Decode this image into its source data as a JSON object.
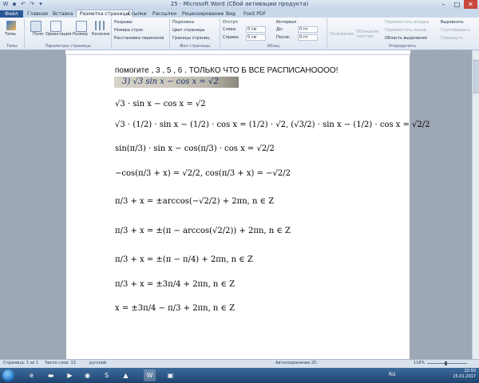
{
  "window": {
    "title": "25 - Microsoft Word (Сбой активации продукта)"
  },
  "tabs": [
    "Файл",
    "Главная",
    "Вставка",
    "Разметка страницы",
    "Ссылки",
    "Рассылки",
    "Рецензирование",
    "Вид",
    "Foxit PDF"
  ],
  "ribbon": {
    "themes": {
      "label": "Темы",
      "group": "Темы"
    },
    "page_setup": {
      "fields": "Поля",
      "orientation": "Ориентация",
      "size": "Размер",
      "columns": "Колонки",
      "breaks": "Разрывы",
      "line_numbers": "Номера строк",
      "hyphenation": "Расстановка переносов",
      "group": "Параметры страницы"
    },
    "background": {
      "watermark": "Подложка",
      "page_color": "Цвет страницы",
      "borders": "Границы страниц",
      "group": "Фон страницы"
    },
    "paragraph": {
      "indent": "Отступ",
      "left": "Слева:",
      "left_val": "0 см",
      "right": "Справа:",
      "right_val": "0 см",
      "spacing": "Интервал",
      "before": "До:",
      "before_val": "0 пт",
      "after": "После:",
      "after_val": "0 пт",
      "group": "Абзац"
    },
    "arrange": {
      "position": "Положение",
      "wrap": "Обтекание текстом",
      "forward": "Переместить вперед",
      "backward": "Переместить назад",
      "selection_pane": "Область выделения",
      "align": "Выровнять",
      "group_obj": "Группировать",
      "rotate": "Повернуть",
      "group": "Упорядочить"
    }
  },
  "document": {
    "question": "помогите , 3 , 5 , 6 . ТОЛЬКО ЧТО Б ВСЕ РАСПИСАНОООО!",
    "photo_text": "3)  √3 sin x  −  cos x = √2",
    "lines": [
      "√3 · sin x − cos x = √2",
      "√3 · (1/2) · sin x − (1/2) · cos x = (1/2) · √2,   (√3/2) · sin x − (1/2) · cos x = √2/2",
      "sin(π/3) · sin x − cos(π/3) · cos x = √2/2",
      "−cos(π/3 + x) = √2/2,   cos(π/3 + x) = −√2/2",
      "π/3 + x = ±arccos(−√2/2) + 2πn, n ∈ Z",
      "π/3 + x = ±(π − arccos(√2/2)) + 2πn, n ∈ Z",
      "π/3 + x = ±(π − π/4) + 2πn, n ∈ Z",
      "π/3 + x = ±3π/4 + 2πn, n ∈ Z",
      "x = ±3π/4 − π/3 + 2πn, n ∈ Z"
    ]
  },
  "status": {
    "page": "Страница: 1 из 1",
    "words": "Число слов: 13",
    "lang": "русский",
    "autosave": "Автосохранение 25:",
    "zoom": "116%"
  },
  "taskbar": {
    "lang": "RU",
    "time": "22:50",
    "date": "25.01.2017"
  }
}
